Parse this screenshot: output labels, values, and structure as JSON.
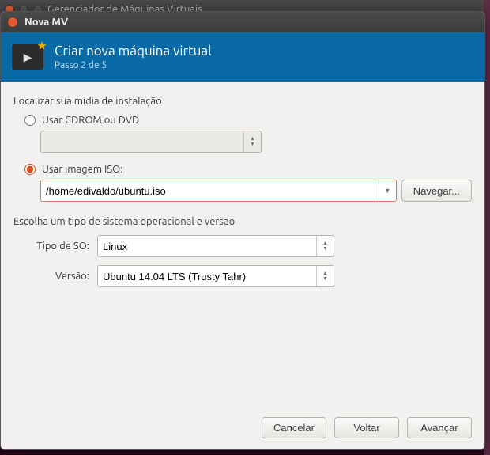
{
  "parent_window": {
    "title": "Gerenciador de Máquinas Virtuais"
  },
  "dialog": {
    "title": "Nova MV",
    "banner": {
      "title": "Criar nova máquina virtual",
      "step": "Passo 2 de 5"
    },
    "media": {
      "section_label": "Localizar sua mídia de instalação",
      "cdrom": {
        "label": "Usar CDROM ou DVD",
        "selected": false,
        "value": ""
      },
      "iso": {
        "label": "Usar imagem ISO:",
        "selected": true,
        "value": "/home/edivaldo/ubuntu.iso",
        "browse_label": "Navegar..."
      }
    },
    "os": {
      "section_label": "Escolha um tipo de sistema operacional e versão",
      "type_label": "Tipo de SO:",
      "type_value": "Linux",
      "version_label": "Versão:",
      "version_value": "Ubuntu 14.04 LTS (Trusty Tahr)"
    },
    "buttons": {
      "cancel": "Cancelar",
      "back": "Voltar",
      "forward": "Avançar"
    }
  }
}
